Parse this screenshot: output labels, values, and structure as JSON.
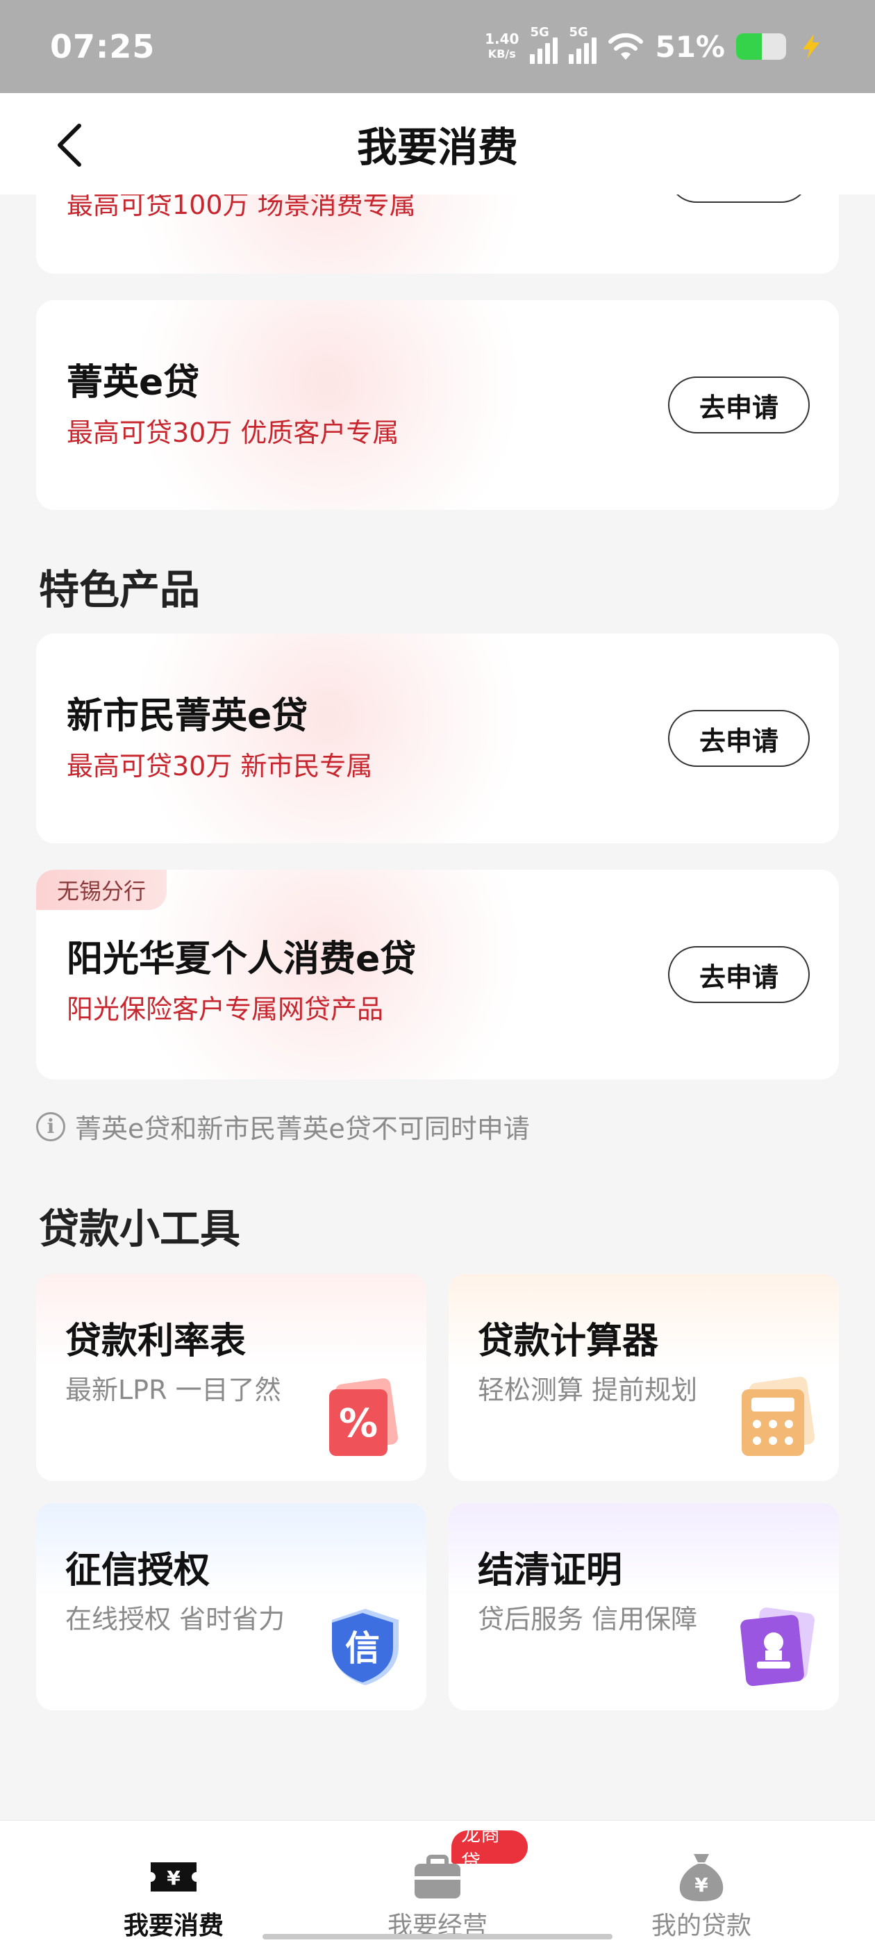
{
  "status_bar": {
    "time": "07:25",
    "net_speed_value": "1.40",
    "net_speed_unit": "KB/s",
    "signal_1_label": "5G",
    "signal_2_label": "5G",
    "battery_percent": "51%",
    "battery_level": 0.51
  },
  "header": {
    "title": "我要消费"
  },
  "top_card_partial": {
    "subtitle": "最高可贷100万 场景消费专属"
  },
  "loan_cards": [
    {
      "title": "菁英e贷",
      "subtitle": "最高可贷30万 优质客户专属",
      "button": "去申请"
    }
  ],
  "featured": {
    "section_title": "特色产品",
    "cards": [
      {
        "title": "新市民菁英e贷",
        "subtitle": "最高可贷30万 新市民专属",
        "button": "去申请"
      },
      {
        "tag": "无锡分行",
        "title": "阳光华夏个人消费e贷",
        "subtitle": "阳光保险客户专属网贷产品",
        "button": "去申请"
      }
    ]
  },
  "notice": {
    "icon": "info-icon",
    "text": "菁英e贷和新市民菁英e贷不可同时申请"
  },
  "tools": {
    "section_title": "贷款小工具",
    "items": [
      {
        "title": "贷款利率表",
        "subtitle": "最新LPR 一目了然",
        "icon": "percent-icon"
      },
      {
        "title": "贷款计算器",
        "subtitle": "轻松测算 提前规划",
        "icon": "calculator-icon"
      },
      {
        "title": "征信授权",
        "subtitle": "在线授权 省时省力",
        "icon": "credit-shield-icon",
        "icon_text": "信"
      },
      {
        "title": "结清证明",
        "subtitle": "贷后服务 信用保障",
        "icon": "certificate-icon"
      }
    ]
  },
  "tabbar": {
    "tabs": [
      {
        "label": "我要消费",
        "icon": "ticket-yen-icon",
        "active": true
      },
      {
        "label": "我要经营",
        "icon": "briefcase-icon",
        "badge": "龙商贷"
      },
      {
        "label": "我的贷款",
        "icon": "money-bag-icon"
      }
    ]
  },
  "colors": {
    "accent_red": "#c8262e",
    "badge_red": "#e9323b",
    "status_bar_bg": "#aeaeae",
    "battery_green": "#35d34a"
  }
}
